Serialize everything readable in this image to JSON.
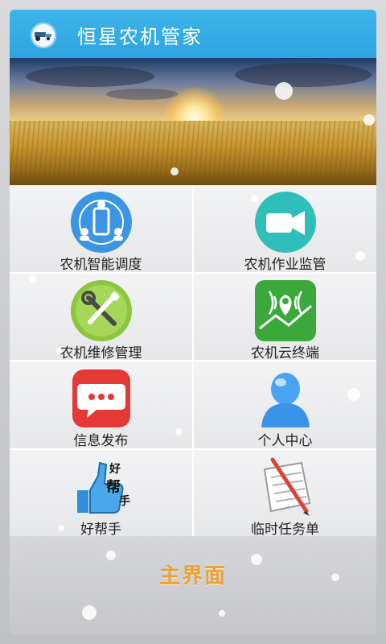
{
  "header": {
    "title": "恒星农机管家",
    "logo_icon": "tractor-icon"
  },
  "banner": {
    "image": "wheat-field-sunset"
  },
  "menu": [
    {
      "label": "农机智能调度",
      "icon": "dispatch-icon",
      "color": "#3b95e3"
    },
    {
      "label": "农机作业监管",
      "icon": "video-camera-icon",
      "color": "#2fbfb8"
    },
    {
      "label": "农机维修管理",
      "icon": "wrench-screwdriver-icon",
      "color": "#8cc63e"
    },
    {
      "label": "农机云终端",
      "icon": "location-signal-icon",
      "color": "#3aa83a"
    },
    {
      "label": "信息发布",
      "icon": "chat-bubble-icon",
      "color": "#e53935"
    },
    {
      "label": "个人中心",
      "icon": "user-icon",
      "color": "#4aa3f0"
    },
    {
      "label": "好帮手",
      "icon": "thumbs-up-icon",
      "color": "#2f8fd8",
      "icon_text": [
        "好",
        "帮",
        "手"
      ]
    },
    {
      "label": "临时任务单",
      "icon": "notepad-pencil-icon",
      "color": "#d8463a"
    }
  ],
  "bottom": {
    "main_label": "主界面"
  },
  "colors": {
    "header": "#35abe5",
    "accent": "#e9a23a"
  }
}
